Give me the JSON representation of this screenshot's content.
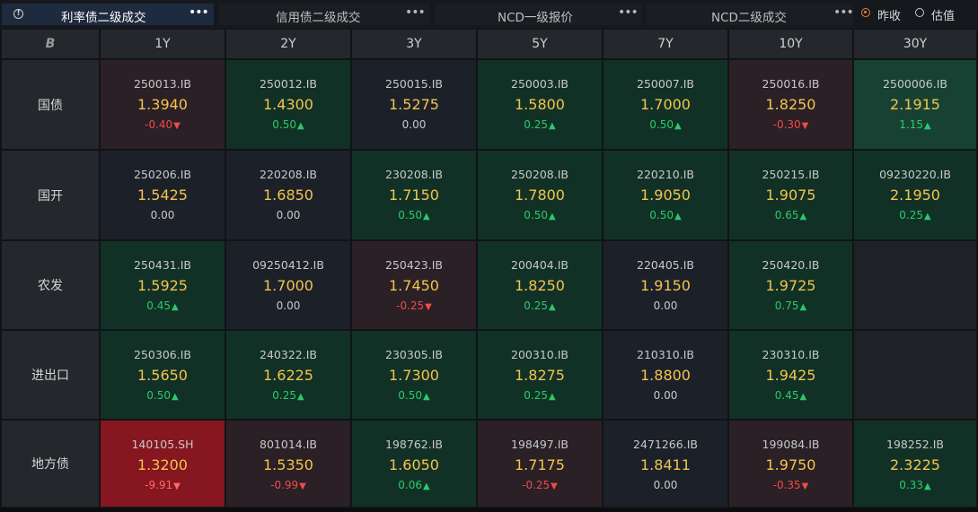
{
  "tabs": [
    {
      "label": "利率债二级成交",
      "more": "•••",
      "active": true
    },
    {
      "label": "信用债二级成交",
      "more": "•••",
      "active": false
    },
    {
      "label": "NCD一级报价",
      "more": "•••",
      "active": false
    },
    {
      "label": "NCD二级成交",
      "more": "•••",
      "active": false
    }
  ],
  "options": [
    {
      "label": "昨收",
      "selected": true
    },
    {
      "label": "估值",
      "selected": false
    }
  ],
  "columns": [
    "1Y",
    "2Y",
    "3Y",
    "5Y",
    "7Y",
    "10Y",
    "30Y"
  ],
  "rows": [
    {
      "name": "国债",
      "cells": [
        {
          "code": "250013.IB",
          "yield": "1.3940",
          "change": "-0.40",
          "dir": "down",
          "tone": "down"
        },
        {
          "code": "250012.IB",
          "yield": "1.4300",
          "change": "0.50",
          "dir": "up",
          "tone": "up"
        },
        {
          "code": "250015.IB",
          "yield": "1.5275",
          "change": "0.00",
          "dir": "flat",
          "tone": "flat"
        },
        {
          "code": "250003.IB",
          "yield": "1.5800",
          "change": "0.25",
          "dir": "up",
          "tone": "up"
        },
        {
          "code": "250007.IB",
          "yield": "1.7000",
          "change": "0.50",
          "dir": "up",
          "tone": "up"
        },
        {
          "code": "250016.IB",
          "yield": "1.8250",
          "change": "-0.30",
          "dir": "down",
          "tone": "down"
        },
        {
          "code": "2500006.IB",
          "yield": "2.1915",
          "change": "1.15",
          "dir": "up",
          "tone": "strongup"
        }
      ]
    },
    {
      "name": "国开",
      "cells": [
        {
          "code": "250206.IB",
          "yield": "1.5425",
          "change": "0.00",
          "dir": "flat",
          "tone": "flat"
        },
        {
          "code": "220208.IB",
          "yield": "1.6850",
          "change": "0.00",
          "dir": "flat",
          "tone": "flat"
        },
        {
          "code": "230208.IB",
          "yield": "1.7150",
          "change": "0.50",
          "dir": "up",
          "tone": "up"
        },
        {
          "code": "250208.IB",
          "yield": "1.7800",
          "change": "0.50",
          "dir": "up",
          "tone": "up"
        },
        {
          "code": "220210.IB",
          "yield": "1.9050",
          "change": "0.50",
          "dir": "up",
          "tone": "up"
        },
        {
          "code": "250215.IB",
          "yield": "1.9075",
          "change": "0.65",
          "dir": "up",
          "tone": "up"
        },
        {
          "code": "09230220.IB",
          "yield": "2.1950",
          "change": "0.25",
          "dir": "up",
          "tone": "up"
        }
      ]
    },
    {
      "name": "农发",
      "cells": [
        {
          "code": "250431.IB",
          "yield": "1.5925",
          "change": "0.45",
          "dir": "up",
          "tone": "up"
        },
        {
          "code": "09250412.IB",
          "yield": "1.7000",
          "change": "0.00",
          "dir": "flat",
          "tone": "flat"
        },
        {
          "code": "250423.IB",
          "yield": "1.7450",
          "change": "-0.25",
          "dir": "down",
          "tone": "down"
        },
        {
          "code": "200404.IB",
          "yield": "1.8250",
          "change": "0.25",
          "dir": "up",
          "tone": "up"
        },
        {
          "code": "220405.IB",
          "yield": "1.9150",
          "change": "0.00",
          "dir": "flat",
          "tone": "flat"
        },
        {
          "code": "250420.IB",
          "yield": "1.9725",
          "change": "0.75",
          "dir": "up",
          "tone": "up"
        },
        null
      ]
    },
    {
      "name": "进出口",
      "cells": [
        {
          "code": "250306.IB",
          "yield": "1.5650",
          "change": "0.50",
          "dir": "up",
          "tone": "up"
        },
        {
          "code": "240322.IB",
          "yield": "1.6225",
          "change": "0.25",
          "dir": "up",
          "tone": "up"
        },
        {
          "code": "230305.IB",
          "yield": "1.7300",
          "change": "0.50",
          "dir": "up",
          "tone": "up"
        },
        {
          "code": "200310.IB",
          "yield": "1.8275",
          "change": "0.25",
          "dir": "up",
          "tone": "up"
        },
        {
          "code": "210310.IB",
          "yield": "1.8800",
          "change": "0.00",
          "dir": "flat",
          "tone": "flat"
        },
        {
          "code": "230310.IB",
          "yield": "1.9425",
          "change": "0.45",
          "dir": "up",
          "tone": "up"
        },
        null
      ]
    },
    {
      "name": "地方债",
      "cells": [
        {
          "code": "140105.SH",
          "yield": "1.3200",
          "change": "-9.91",
          "dir": "down",
          "tone": "strongdown"
        },
        {
          "code": "801014.IB",
          "yield": "1.5350",
          "change": "-0.99",
          "dir": "down",
          "tone": "down"
        },
        {
          "code": "198762.IB",
          "yield": "1.6050",
          "change": "0.06",
          "dir": "up",
          "tone": "up"
        },
        {
          "code": "198497.IB",
          "yield": "1.7175",
          "change": "-0.25",
          "dir": "down",
          "tone": "down"
        },
        {
          "code": "2471266.IB",
          "yield": "1.8411",
          "change": "0.00",
          "dir": "flat",
          "tone": "flat"
        },
        {
          "code": "199084.IB",
          "yield": "1.9750",
          "change": "-0.35",
          "dir": "down",
          "tone": "down"
        },
        {
          "code": "198252.IB",
          "yield": "2.3225",
          "change": "0.33",
          "dir": "up",
          "tone": "up"
        }
      ]
    }
  ],
  "icons": {
    "info": "info-circle-icon",
    "corner": "brand-logo-icon",
    "up": "triangle-up-icon",
    "down": "triangle-down-icon"
  },
  "colors": {
    "up_text": "#2cc96b",
    "down_text": "#f04b4b",
    "yield_text": "#f3c44c",
    "active_tab": "#1e2a3d",
    "radio_selected": "#f08030"
  }
}
